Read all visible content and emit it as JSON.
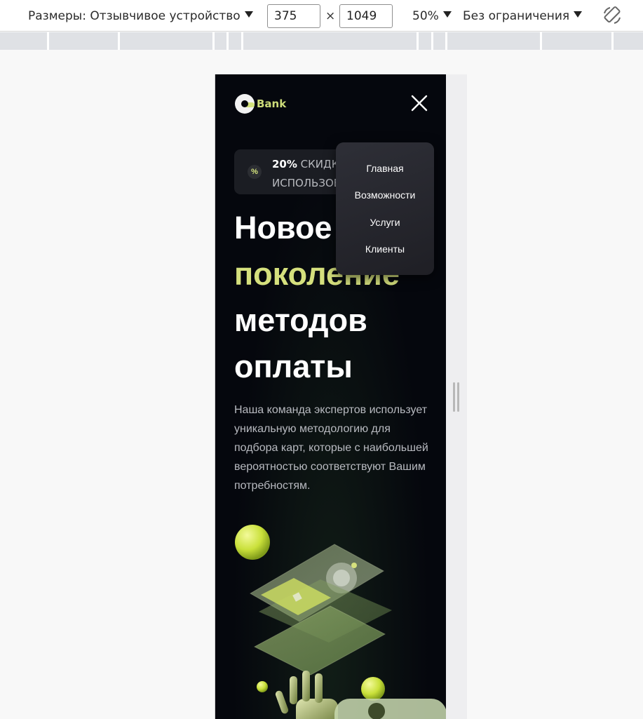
{
  "devtools": {
    "dimensions_label": "Размеры: Отзывчивое устройство",
    "width_value": "375",
    "times_sign": "×",
    "height_value": "1049",
    "zoom": "50%",
    "throttling": "Без ограничения",
    "rotate_icon": "rotate-icon"
  },
  "site": {
    "logo_text": "Bank",
    "close_icon": "close-icon",
    "badge": {
      "percent_icon": "%",
      "line1_bold": "20%",
      "line1_rest": " СКИДКА",
      "line2": "ИСПОЛЬЗОВ"
    },
    "hero": {
      "line1": "Новое",
      "line2": "поколение",
      "line3": "методов",
      "line4": "оплаты"
    },
    "description": "Наша команда экспертов использует уникальную методологию для подбора карт, которые с наибольшей вероятностью соответствуют Вашим потребностям.",
    "menu": [
      {
        "label": "Главная"
      },
      {
        "label": "Возможности"
      },
      {
        "label": "Услуги"
      },
      {
        "label": "Клиенты"
      }
    ],
    "colors": {
      "accent": "#d5e07d",
      "background": "#05070d",
      "menu_bg": "#2a2b32"
    }
  }
}
